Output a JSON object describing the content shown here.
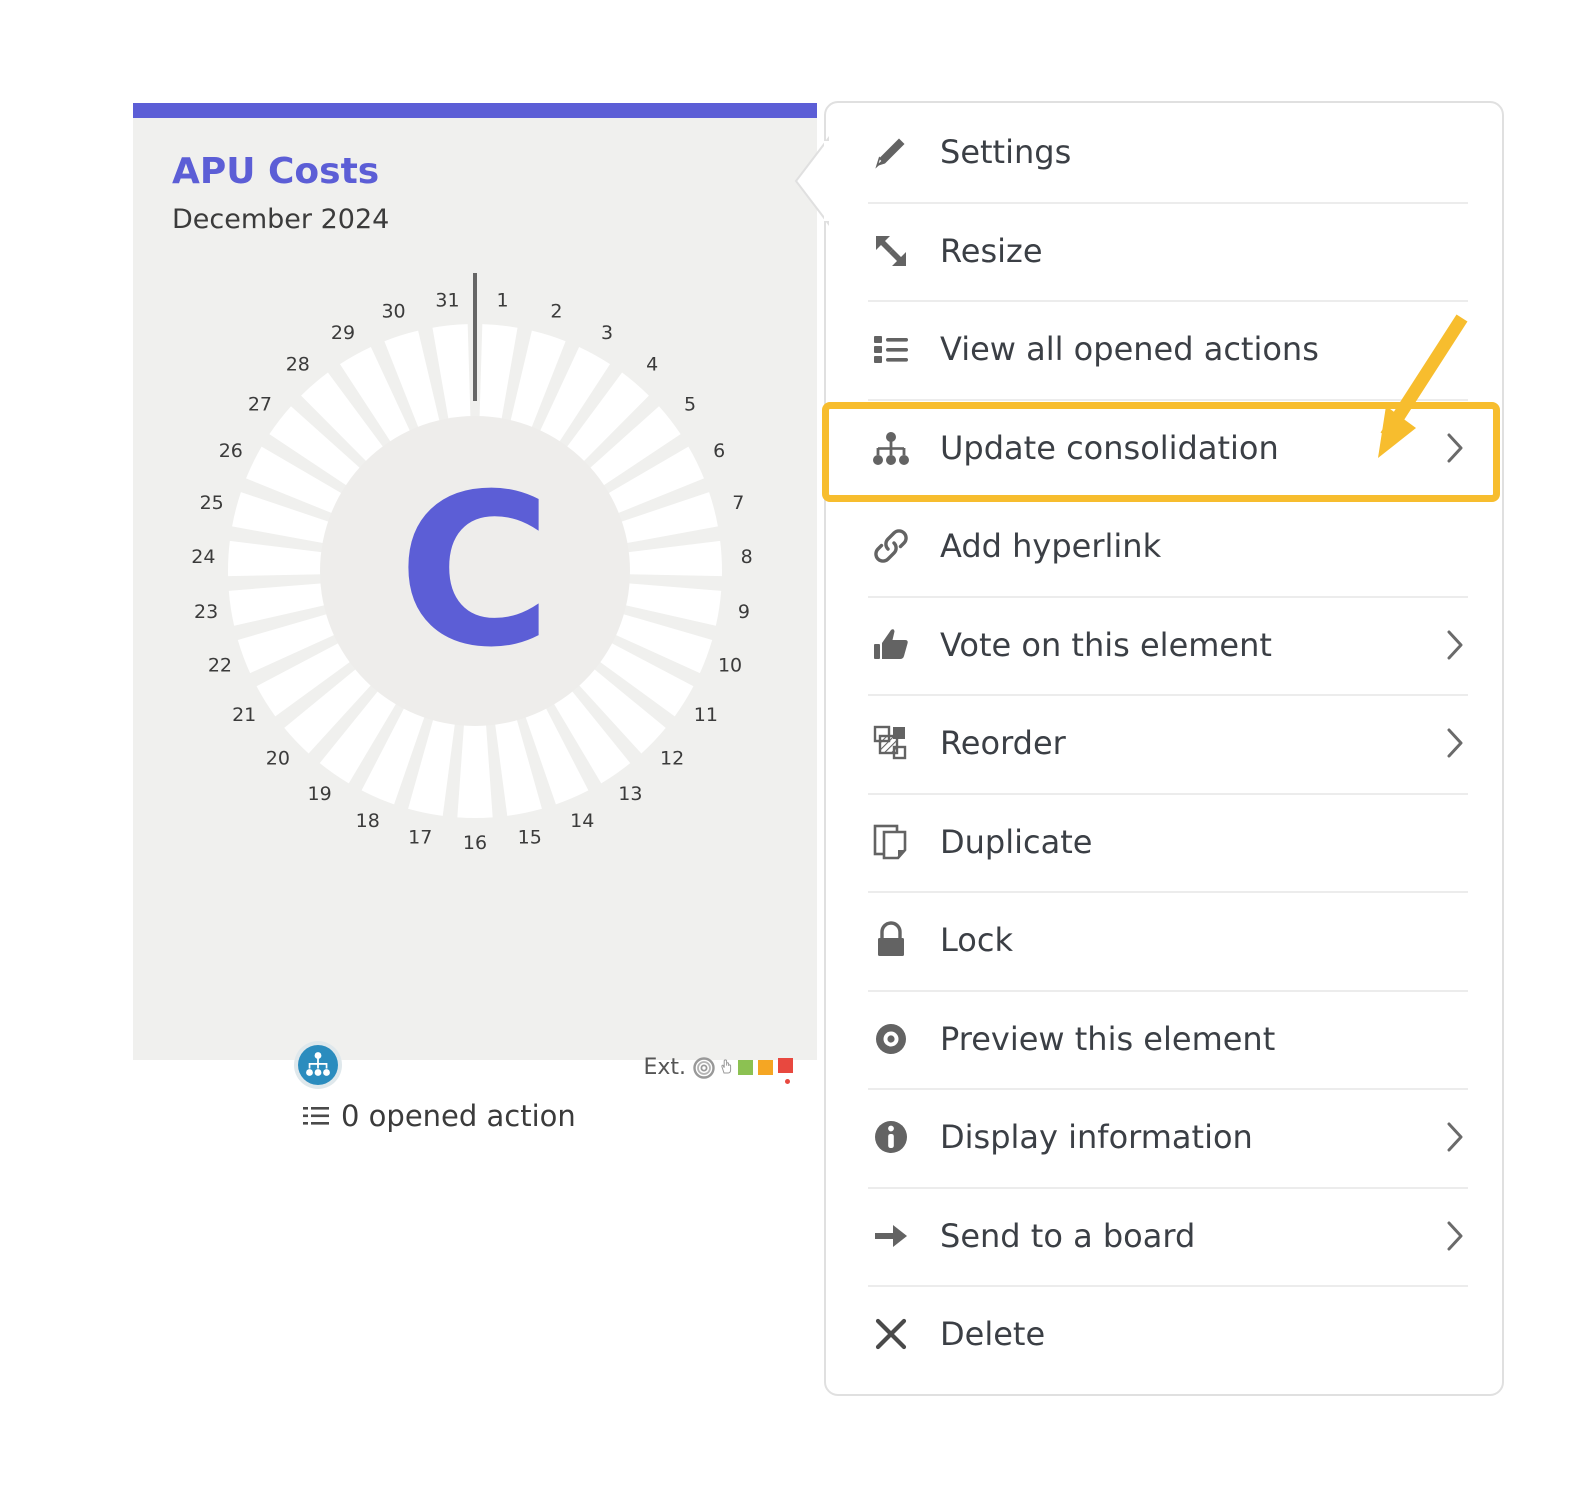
{
  "card": {
    "accent_color": "#5c5ed6",
    "background_color": "#f0f0ee",
    "title": "APU Costs",
    "subtitle": "December 2024",
    "center_letter": "C",
    "start_marker_color": "#666666",
    "footer": {
      "consolidation_badge_icon": "hierarchy-icon",
      "consolidation_badge_color": "#2b8cbe",
      "ext_label": "Ext.",
      "ext_icons": [
        "bullseye-icon",
        "hand-pointer-icon"
      ],
      "ext_status_colors": [
        "#8cc152",
        "#f5a623",
        "#e8483f"
      ],
      "actions_icon": "list-icon",
      "actions_text": "0 opened action"
    }
  },
  "chart_data": {
    "type": "pie",
    "title": "APU Costs",
    "subtitle": "December 2024",
    "center_label": "C",
    "segment_count": 31,
    "categories": [
      "1",
      "2",
      "3",
      "4",
      "5",
      "6",
      "7",
      "8",
      "9",
      "10",
      "11",
      "12",
      "13",
      "14",
      "15",
      "16",
      "17",
      "18",
      "19",
      "20",
      "21",
      "22",
      "23",
      "24",
      "25",
      "26",
      "27",
      "28",
      "29",
      "30",
      "31"
    ],
    "values": [
      1,
      1,
      1,
      1,
      1,
      1,
      1,
      1,
      1,
      1,
      1,
      1,
      1,
      1,
      1,
      1,
      1,
      1,
      1,
      1,
      1,
      1,
      1,
      1,
      1,
      1,
      1,
      1,
      1,
      1,
      1
    ],
    "tick_labels": [
      "1",
      "2",
      "3",
      "4",
      "5",
      "6",
      "7",
      "8",
      "9",
      "10",
      "11",
      "12",
      "13",
      "14",
      "15",
      "16",
      "17",
      "18",
      "19",
      "20",
      "21",
      "22",
      "23",
      "24",
      "25",
      "26",
      "27",
      "28",
      "29",
      "30",
      "31"
    ],
    "segment_color": "#ffffff",
    "inner_disc_color": "#eeedeb",
    "label_color": "#3b3b3b",
    "grid": false,
    "legend": "none",
    "xlabel": "",
    "ylabel": ""
  },
  "menu": {
    "highlight_color": "#f7bd2e",
    "annotation": "arrow-pointing-to-update-consolidation",
    "items": [
      {
        "label": "Settings",
        "icon": "pencil-icon",
        "submenu": false
      },
      {
        "label": "Resize",
        "icon": "resize-icon",
        "submenu": false
      },
      {
        "label": "View all opened actions",
        "icon": "list-icon",
        "submenu": false
      },
      {
        "label": "Update consolidation",
        "icon": "hierarchy-icon",
        "submenu": true
      },
      {
        "label": "Add hyperlink",
        "icon": "link-icon",
        "submenu": false
      },
      {
        "label": "Vote on this element",
        "icon": "thumbs-up-icon",
        "submenu": true
      },
      {
        "label": "Reorder",
        "icon": "reorder-icon",
        "submenu": true
      },
      {
        "label": "Duplicate",
        "icon": "duplicate-icon",
        "submenu": false
      },
      {
        "label": "Lock",
        "icon": "lock-icon",
        "submenu": false
      },
      {
        "label": "Preview this element",
        "icon": "eye-icon",
        "submenu": false
      },
      {
        "label": "Display information",
        "icon": "info-icon",
        "submenu": true
      },
      {
        "label": "Send to a board",
        "icon": "arrow-right-icon",
        "submenu": true
      },
      {
        "label": "Delete",
        "icon": "close-x-icon",
        "submenu": false
      }
    ]
  }
}
